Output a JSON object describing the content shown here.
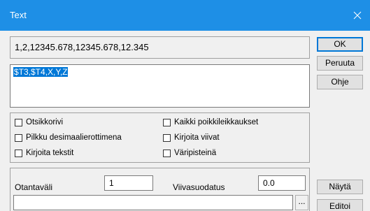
{
  "window": {
    "title": "Text",
    "colors": {
      "titlebar": "#1e8fe6",
      "selection": "#0078d7"
    }
  },
  "display_field": {
    "value": "1,2,12345.678,12345.678,12.345"
  },
  "format_field": {
    "value": "$T3,$T4,X,Y,Z",
    "selected": true
  },
  "buttons": {
    "ok": "OK",
    "cancel": "Peruuta",
    "help": "Ohje",
    "show": "Näytä",
    "edit": "Editoi",
    "browse": "..."
  },
  "options": [
    {
      "label": "Otsikkorivi",
      "checked": false
    },
    {
      "label": "Pilkku desimaalierottimena",
      "checked": false
    },
    {
      "label": "Kirjoita tekstit",
      "checked": false
    },
    {
      "label": "Kaikki poikkileikkaukset",
      "checked": false
    },
    {
      "label": "Kirjoita viivat",
      "checked": false
    },
    {
      "label": "Väripisteinä",
      "checked": false
    }
  ],
  "sampling": {
    "label": "Otantaväli",
    "value": "1"
  },
  "line_filter": {
    "label": "Viivasuodatus",
    "value": "0.0"
  },
  "file_path": {
    "value": ""
  },
  "icons": {
    "close": "close-icon"
  }
}
